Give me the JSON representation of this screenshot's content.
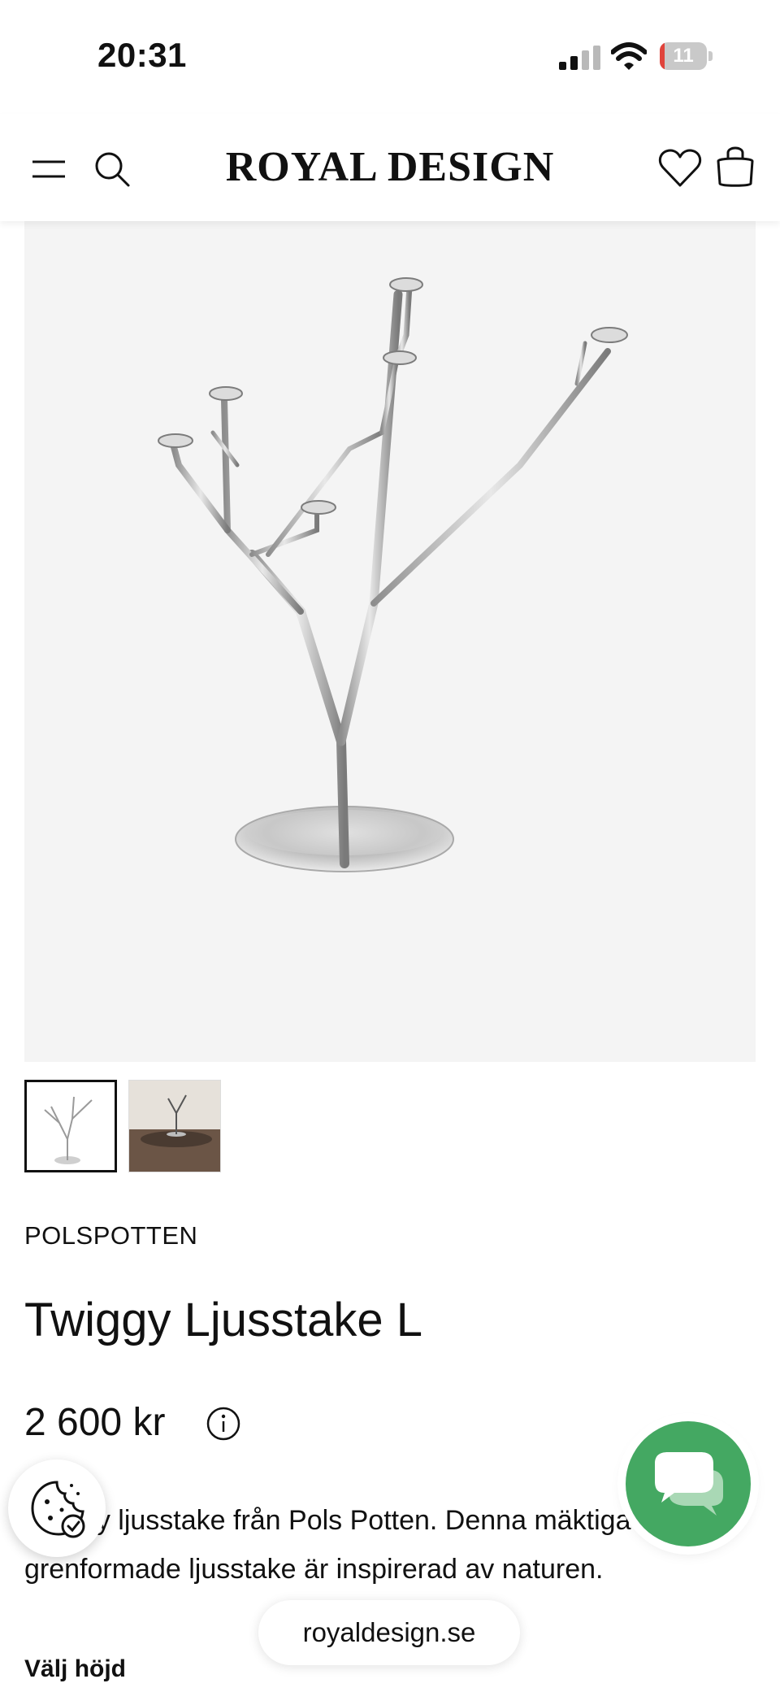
{
  "status_bar": {
    "time": "20:31",
    "battery_level": "11",
    "battery_color": "#e0433b"
  },
  "header": {
    "logo": "ROYAL DESIGN"
  },
  "gallery": {
    "main_image_alt": "Twiggy Ljusstake L",
    "thumbnails": [
      "thumbnail-product",
      "thumbnail-interior"
    ],
    "selected_index": 0
  },
  "product": {
    "brand": "POLSPOTTEN",
    "title": "Twiggy Ljusstake L",
    "price": "2 600 kr",
    "description_line1": "Twiggy ljusstake från Pols Potten. Denna mäktiga",
    "description_line2": "grenformade ljusstake är inspirerad av naturen.",
    "choose_height_label": "Välj höjd"
  },
  "browser": {
    "url": "royaldesign.se"
  },
  "colors": {
    "chat_green": "#44a862",
    "image_bg": "#f4f4f4"
  },
  "icons": [
    "menu-icon",
    "search-icon",
    "heart-icon",
    "bag-icon",
    "info-icon",
    "cookie-icon",
    "chat-icon",
    "signal-icon",
    "wifi-icon",
    "battery-icon"
  ]
}
